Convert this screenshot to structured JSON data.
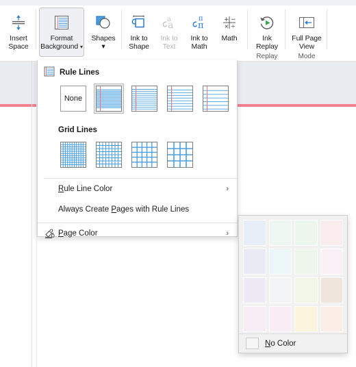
{
  "ribbon": {
    "groups": [
      {
        "name": "insert-space-group",
        "label": "",
        "buttons": [
          {
            "id": "insert-space",
            "icon": "insert-space-icon",
            "line1": "Insert",
            "line2": "Space",
            "state": "normal",
            "chevron": false
          }
        ]
      },
      {
        "name": "format-background-group",
        "label": "",
        "buttons": [
          {
            "id": "format-background",
            "icon": "ruled-paper-icon",
            "line1": "Format",
            "line2": "Background",
            "state": "active",
            "chevron": true
          }
        ]
      },
      {
        "name": "shapes-group",
        "label": "",
        "buttons": [
          {
            "id": "shapes",
            "icon": "shapes-icon",
            "line1": "Shapes",
            "line2": "",
            "state": "normal",
            "chevron": true
          }
        ]
      },
      {
        "name": "convert-group",
        "label": "",
        "buttons": [
          {
            "id": "ink-to-shape",
            "icon": "ink-to-shape-icon",
            "line1": "Ink to",
            "line2": "Shape",
            "state": "normal",
            "chevron": false
          },
          {
            "id": "ink-to-text",
            "icon": "ink-to-text-icon",
            "line1": "Ink to",
            "line2": "Text",
            "state": "disabled",
            "chevron": false
          },
          {
            "id": "ink-to-math",
            "icon": "ink-to-math-icon",
            "line1": "Ink to",
            "line2": "Math",
            "state": "normal",
            "chevron": false
          },
          {
            "id": "math",
            "icon": "math-icon",
            "line1": "Math",
            "line2": "",
            "state": "normal",
            "chevron": false
          }
        ]
      },
      {
        "name": "replay-group",
        "label": "Replay",
        "buttons": [
          {
            "id": "ink-replay",
            "icon": "ink-replay-icon",
            "line1": "Ink",
            "line2": "Replay",
            "state": "normal",
            "chevron": false
          }
        ]
      },
      {
        "name": "mode-group",
        "label": "Mode",
        "buttons": [
          {
            "id": "full-page-view",
            "icon": "full-page-view-icon",
            "line1": "Full Page",
            "line2": "View",
            "state": "normal",
            "chevron": false
          }
        ]
      }
    ]
  },
  "background_menu": {
    "rule_lines": {
      "icon": "ruled-paper-icon",
      "title": "Rule Lines",
      "none_label": "None",
      "options": [
        {
          "id": "none",
          "label": "None",
          "type": "none",
          "selected": false
        },
        {
          "id": "narrow-ruled",
          "label": "Narrow Ruled",
          "type": "lines",
          "line_count": 14,
          "selected": true
        },
        {
          "id": "college-ruled",
          "label": "College Ruled",
          "type": "lines",
          "line_count": 11,
          "selected": false
        },
        {
          "id": "standard-ruled",
          "label": "Standard Ruled",
          "type": "lines",
          "line_count": 8,
          "selected": false
        },
        {
          "id": "wide-ruled",
          "label": "Wide Ruled",
          "type": "lines",
          "line_count": 6,
          "selected": false
        }
      ]
    },
    "grid_lines": {
      "title": "Grid Lines",
      "options": [
        {
          "id": "small-grid",
          "label": "Small Grid",
          "cells": 11,
          "selected": false
        },
        {
          "id": "medium-grid",
          "label": "Medium Grid",
          "cells": 8,
          "selected": false
        },
        {
          "id": "large-grid",
          "label": "Large Grid",
          "cells": 5,
          "selected": false
        },
        {
          "id": "very-large-grid",
          "label": "Very Large Grid",
          "cells": 4,
          "selected": false
        }
      ]
    },
    "items": [
      {
        "id": "rule-line-color",
        "icon": "",
        "label": "Rule Line Color",
        "accel": "R",
        "submenu": true
      },
      {
        "id": "always-create-pages",
        "icon": "",
        "label": "Always Create Pages with Rule Lines",
        "accel": "P",
        "submenu": false
      },
      {
        "id": "page-color",
        "icon": "page-color-icon",
        "label": "Page Color",
        "accel": "P",
        "submenu": true
      }
    ]
  },
  "color_flyout": {
    "name": "page-color-palette",
    "swatches": [
      "#e8eef7",
      "#edf6f1",
      "#ebf7ec",
      "#fbeced",
      "#eaeaf5",
      "#ebf6f7",
      "#eef6ea",
      "#fbf0f5",
      "#eeeaf5",
      "#f3f4f6",
      "#f2f6e8",
      "#f0e5dc",
      "#f7eef5",
      "#faecf3",
      "#fdf4dd",
      "#faeee6"
    ],
    "no_color_label": "No Color",
    "no_color_accel": "N"
  },
  "colors": {
    "accent": "#2b7cd3",
    "rule_red": "#f0737f",
    "page_header_band": "#e9edf1",
    "active_button_bg": "#eef0f3"
  }
}
